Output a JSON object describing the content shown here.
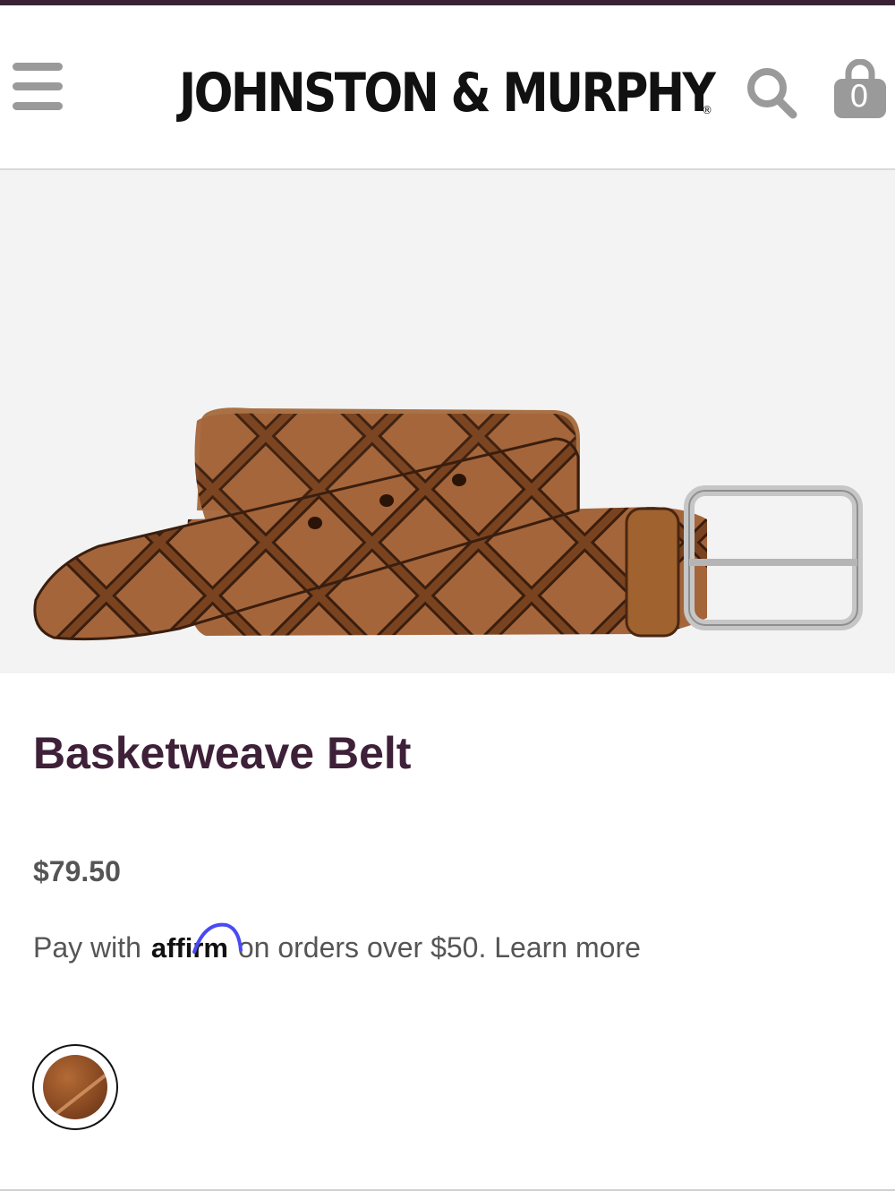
{
  "header": {
    "brand": "JOHNSTON & MURPHY",
    "registered_mark": "®",
    "menu_icon": "hamburger-menu-icon",
    "search_icon": "search-icon",
    "bag_icon": "shopping-bag-icon",
    "bag_count": "0"
  },
  "product": {
    "title": "Basketweave Belt",
    "price": "$79.50",
    "affirm": {
      "prefix": "Pay with",
      "brand": "affirm",
      "suffix": "on orders over $50.",
      "link": "Learn more"
    },
    "swatch_color": "#8a4a22"
  },
  "colors": {
    "accent": "#3e2139",
    "top_bar": "#3a2235",
    "affirm_arc": "#4a4af4",
    "image_bg": "#f3f3f3"
  }
}
